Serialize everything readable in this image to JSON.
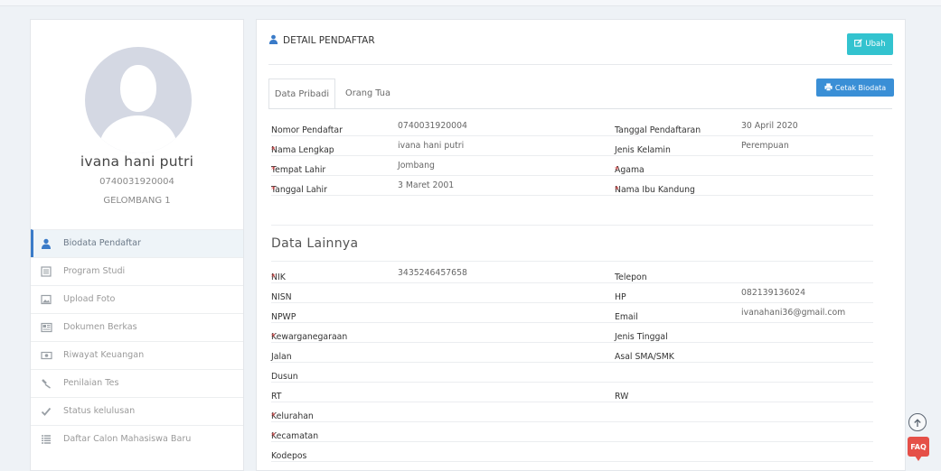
{
  "profile": {
    "name": "ivana hani putri",
    "number": "0740031920004",
    "wave": "GELOMBANG 1"
  },
  "menu": [
    {
      "label": "Biodata Pendaftar",
      "icon": "user-icon",
      "active": true
    },
    {
      "label": "Program Studi",
      "icon": "list-box-icon"
    },
    {
      "label": "Upload Foto",
      "icon": "image-icon"
    },
    {
      "label": "Dokumen Berkas",
      "icon": "newspaper-icon"
    },
    {
      "label": "Riwayat Keuangan",
      "icon": "money-icon"
    },
    {
      "label": "Penilaian Tes",
      "icon": "gavel-icon"
    },
    {
      "label": "Status kelulusan",
      "icon": "check-icon"
    },
    {
      "label": "Daftar Calon Mahasiswa Baru",
      "icon": "list-icon"
    }
  ],
  "panel": {
    "title": "DETAIL PENDAFTAR",
    "edit_label": "Ubah",
    "print_label": "Cetak Biodata",
    "tabs": [
      "Data Pribadi",
      "Orang Tua"
    ]
  },
  "personal": [
    {
      "l1": "Nomor Pendaftar",
      "r1": false,
      "v1": "0740031920004",
      "l2": "Tanggal Pendaftaran",
      "r2": false,
      "v2": "30 April 2020"
    },
    {
      "l1": "Nama Lengkap",
      "r1": true,
      "v1": "ivana hani putri",
      "l2": "Jenis Kelamin",
      "r2": false,
      "v2": "Perempuan"
    },
    {
      "l1": "Tempat Lahir",
      "r1": true,
      "v1": "Jombang",
      "l2": "Agama",
      "r2": true,
      "v2": ""
    },
    {
      "l1": "Tanggal Lahir",
      "r1": true,
      "v1": "3 Maret 2001",
      "l2": "Nama Ibu Kandung",
      "r2": true,
      "v2": ""
    }
  ],
  "other_section_title": "Data Lainnya",
  "other": [
    {
      "l1": "NIK",
      "r1": true,
      "v1": "3435246457658",
      "l2": "Telepon",
      "r2": false,
      "v2": ""
    },
    {
      "l1": "NISN",
      "r1": false,
      "v1": "",
      "l2": "HP",
      "r2": false,
      "v2": "082139136024"
    },
    {
      "l1": "NPWP",
      "r1": false,
      "v1": "",
      "l2": "Email",
      "r2": false,
      "v2": "ivanahani36@gmail.com"
    },
    {
      "l1": "Kewarganegaraan",
      "r1": true,
      "v1": "",
      "l2": "Jenis Tinggal",
      "r2": false,
      "v2": ""
    },
    {
      "l1": "Jalan",
      "r1": false,
      "v1": "",
      "l2": "Asal SMA/SMK",
      "r2": false,
      "v2": ""
    },
    {
      "l1": "Dusun",
      "r1": false,
      "v1": "",
      "l2": "",
      "r2": false,
      "v2": ""
    },
    {
      "l1": "RT",
      "r1": false,
      "v1": "",
      "l2": "RW",
      "r2": false,
      "v2": ""
    },
    {
      "l1": "Kelurahan",
      "r1": true,
      "v1": "",
      "l2": "",
      "r2": false,
      "v2": ""
    },
    {
      "l1": "Kecamatan",
      "r1": true,
      "v1": "",
      "l2": "",
      "r2": false,
      "v2": ""
    },
    {
      "l1": "Kodepos",
      "r1": false,
      "v1": "",
      "l2": "",
      "r2": false,
      "v2": ""
    }
  ],
  "required_mark": "*",
  "faq_label": "FAQ",
  "colors": {
    "accent": "#3a7bc8",
    "edit_button": "#33c3cf",
    "print_button": "#3a8fd6",
    "required": "#e04848",
    "faq": "#e55048"
  }
}
